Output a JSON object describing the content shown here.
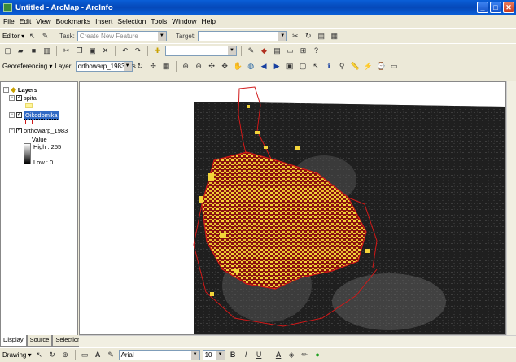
{
  "window": {
    "title": "Untitled - ArcMap - ArcInfo",
    "minimize": "_",
    "maximize": "□",
    "close": "✕"
  },
  "menu": [
    "File",
    "Edit",
    "View",
    "Bookmarks",
    "Insert",
    "Selection",
    "Tools",
    "Window",
    "Help"
  ],
  "editor_toolbar": {
    "editor_label": "Editor ▾",
    "task_label": "Task:",
    "task_value": "Create New Feature",
    "target_label": "Target:",
    "target_value": ""
  },
  "standard_toolbar": {
    "scale_value": ""
  },
  "georef_toolbar": {
    "georef_label": "Georeferencing ▾",
    "layer_label": "Layer:",
    "layer_value": "orthowarp_1983.ers"
  },
  "toc": {
    "root": "Layers",
    "layers": [
      {
        "name": "spita",
        "checked": true
      },
      {
        "name": "Oikodomika",
        "checked": true,
        "selected": true
      },
      {
        "name": "orthowarp_1983",
        "checked": true
      }
    ],
    "legend_title": "Value",
    "legend_high": "High : 255",
    "legend_low": "Low : 0",
    "tabs": [
      "Display",
      "Source",
      "Selection"
    ]
  },
  "drawing_toolbar": {
    "drawing_label": "Drawing ▾",
    "font_value": "Arial",
    "size_value": "10",
    "bold": "B",
    "italic": "I",
    "underline": "U",
    "font_color": "A"
  },
  "colors": {
    "titlebar": "#0a5fd8",
    "map_bg": "#ffffff",
    "raster": "#1a1a1a",
    "buildings": "#f2d43a",
    "outline": "#d01818"
  }
}
